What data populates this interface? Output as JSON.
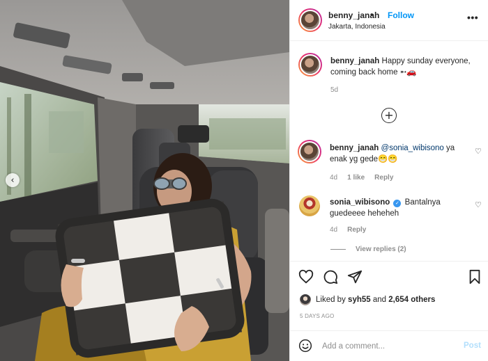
{
  "post": {
    "author": "benny_janah",
    "location": "Jakarta, Indonesia",
    "follow_label": "Follow",
    "separator": "•",
    "more_label": "•••"
  },
  "caption": {
    "username": "benny_janah",
    "text": "Happy sunday everyone, coming back home ➵🚗",
    "age": "5d"
  },
  "load_more_icon": "plus-circle-icon",
  "comments": [
    {
      "username": "benny_janah",
      "mention": "@sonia_wibisono",
      "text": " ya enak yg gede😁😁",
      "age": "4d",
      "likes": "1 like",
      "reply_label": "Reply"
    },
    {
      "username": "sonia_wibisono",
      "verified": true,
      "text": "Bantalnya guedeeee heheheh",
      "age": "4d",
      "reply_label": "Reply",
      "view_replies": "View replies (2)"
    }
  ],
  "actions": {
    "icons": [
      "heart-icon",
      "comment-icon",
      "share-icon",
      "bookmark-icon"
    ]
  },
  "likes": {
    "prefix": "Liked by",
    "user": "syh55",
    "connector": "and",
    "others": "2,654 others"
  },
  "timestamp": "5 DAYS AGO",
  "add_comment": {
    "placeholder": "Add a comment...",
    "post_label": "Post"
  },
  "carousel": {
    "prev_icon": "chevron-left-icon",
    "prev_glyph": "‹"
  },
  "colors": {
    "link_blue": "#0095f6",
    "mention_blue": "#00376b",
    "secondary_text": "#8e8e8e",
    "post_disabled": "#b2dffc",
    "border": "#efefef"
  }
}
